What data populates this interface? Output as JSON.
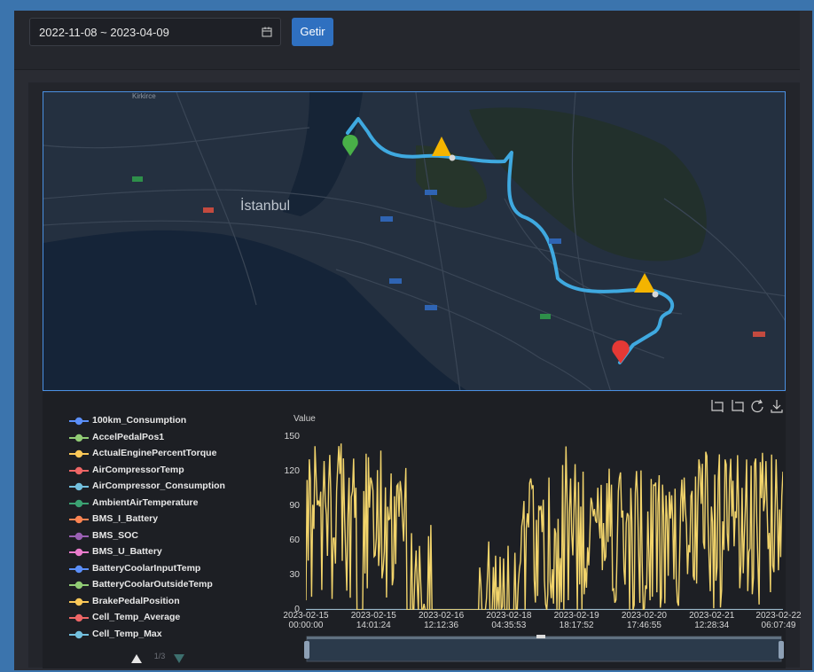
{
  "toolbar": {
    "date_range": "2022-11-08 ~ 2023-04-09",
    "submit_label": "Getir"
  },
  "map": {
    "labels": {
      "istanbul": "İstanbul",
      "kirkkoy": "Kirkirce"
    },
    "colors": {
      "route": "#3fa9e0",
      "start_marker": "#49b048",
      "end_marker": "#e53935",
      "warning": "#f4b400"
    }
  },
  "tools": [
    "crop-icon",
    "undo-zoom-icon",
    "refresh-icon",
    "download-icon"
  ],
  "legend": {
    "items": [
      {
        "label": "100km_Consumption",
        "color": "#5b8ff9"
      },
      {
        "label": "AccelPedalPos1",
        "color": "#91cc75"
      },
      {
        "label": "ActualEnginePercentTorque",
        "color": "#fac858"
      },
      {
        "label": "AirCompressorTemp",
        "color": "#ee6666"
      },
      {
        "label": "AirCompressor_Consumption",
        "color": "#73c0de"
      },
      {
        "label": "AmbientAirTemperature",
        "color": "#3ba272"
      },
      {
        "label": "BMS_I_Battery",
        "color": "#fc8452"
      },
      {
        "label": "BMS_SOC",
        "color": "#9a60b4"
      },
      {
        "label": "BMS_U_Battery",
        "color": "#ea7ccc"
      },
      {
        "label": "BatteryCoolarInputTemp",
        "color": "#5b8ff9"
      },
      {
        "label": "BatteryCoolarOutsideTemp",
        "color": "#91cc75"
      },
      {
        "label": "BrakePedalPosition",
        "color": "#fac858"
      },
      {
        "label": "Cell_Temp_Average",
        "color": "#ee6666"
      },
      {
        "label": "Cell_Temp_Max",
        "color": "#73c0de"
      }
    ],
    "page": "1/3"
  },
  "chart_data": {
    "type": "line",
    "ylabel": "Value",
    "ylim": [
      0,
      150
    ],
    "yticks": [
      0,
      30,
      60,
      90,
      120,
      150
    ],
    "x_ticks": [
      [
        "2023-02-15",
        "00:00:00"
      ],
      [
        "2023-02-15",
        "14:01:24"
      ],
      [
        "2023-02-16",
        "12:12:36"
      ],
      [
        "2023-02-18",
        "04:35:53"
      ],
      [
        "2023-02-19",
        "18:17:52"
      ],
      [
        "2023-02-20",
        "17:46:55"
      ],
      [
        "2023-02-21",
        "12:28:34"
      ],
      [
        "2023-02-22",
        "06:07:49"
      ]
    ],
    "series": [
      {
        "color": "#f2d46b",
        "segments": [
          {
            "from": 0.0,
            "to": 0.105,
            "peak": 145,
            "density": 1
          },
          {
            "from": 0.12,
            "to": 0.21,
            "peak": 140,
            "density": 1
          },
          {
            "from": 0.22,
            "to": 0.27,
            "peak": 80,
            "density": 0.5
          },
          {
            "from": 0.36,
            "to": 0.44,
            "peak": 60,
            "density": 0.4
          },
          {
            "from": 0.445,
            "to": 0.53,
            "peak": 120,
            "density": 0.9
          },
          {
            "from": 0.53,
            "to": 0.57,
            "peak": 142,
            "density": 0.8
          },
          {
            "from": 0.57,
            "to": 0.66,
            "peak": 130,
            "density": 1
          },
          {
            "from": 0.66,
            "to": 0.73,
            "peak": 125,
            "density": 0.9
          },
          {
            "from": 0.73,
            "to": 0.82,
            "peak": 120,
            "density": 1
          },
          {
            "from": 0.82,
            "to": 1.0,
            "peak": 138,
            "density": 1
          }
        ]
      }
    ]
  }
}
